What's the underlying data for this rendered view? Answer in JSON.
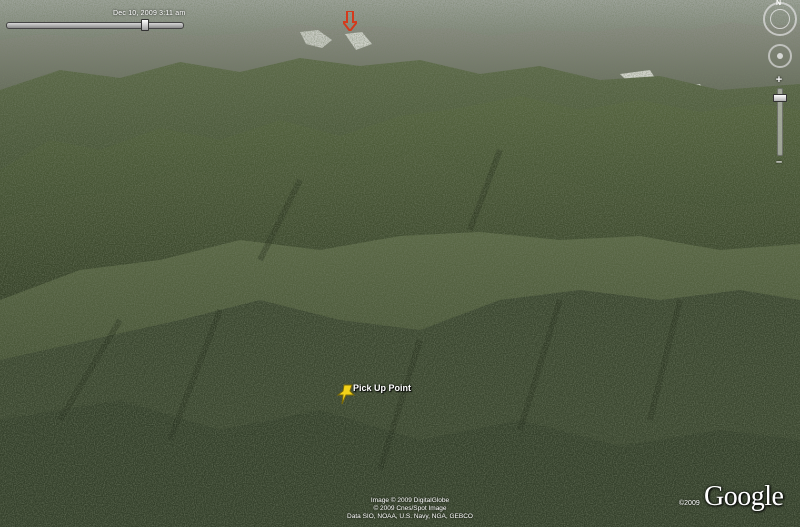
{
  "time_slider": {
    "label": "Dec 10, 2009    3:11 am"
  },
  "placemark": {
    "label": "Pick Up Point"
  },
  "compass": {
    "north": "N"
  },
  "zoom": {
    "plus": "+",
    "minus": "–"
  },
  "attribution": {
    "line1": "Image © 2009 DigitalGlobe",
    "line2": "© 2009 Cnes/Spot Image",
    "line3": "Data SIO, NOAA, U.S. Navy, NGA, GEBCO"
  },
  "logo": {
    "copyright": "©2009",
    "text": "Google"
  },
  "colors": {
    "placemark": "#f2d21a",
    "arrow": "#d43a1c"
  }
}
